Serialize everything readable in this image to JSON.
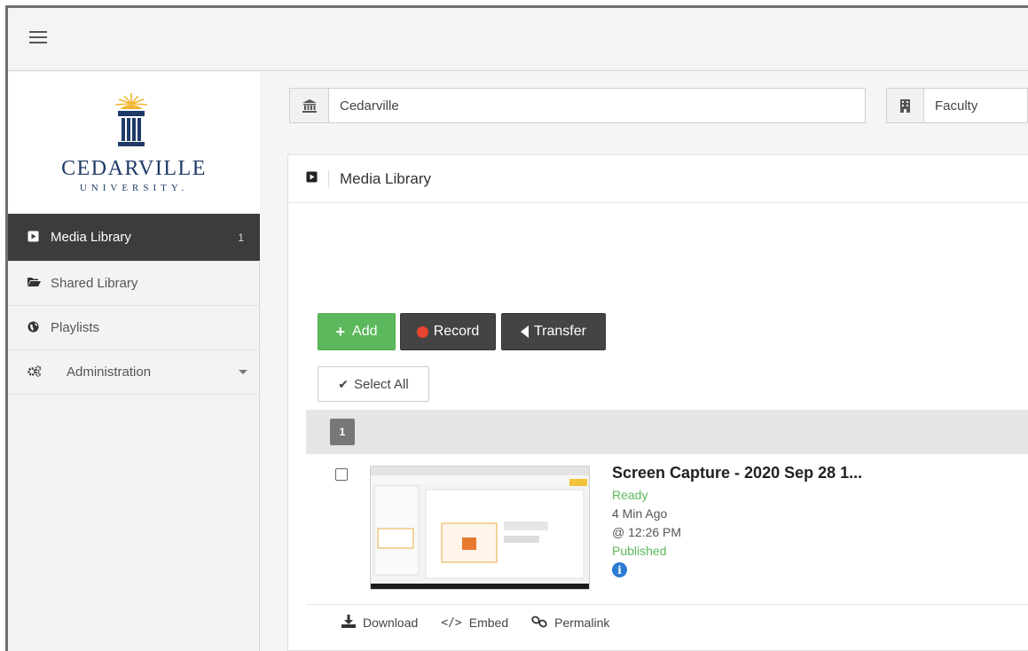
{
  "institution": {
    "value": "Cedarville"
  },
  "department": {
    "value": "Faculty"
  },
  "logo": {
    "name": "CEDARVILLE",
    "subtitle": "UNIVERSITY."
  },
  "sidebar": {
    "items": [
      {
        "label": "Media Library",
        "badge": "1",
        "icon": "play-square-icon"
      },
      {
        "label": "Shared Library",
        "icon": "folder-open-icon"
      },
      {
        "label": "Playlists",
        "icon": "globe-icon"
      },
      {
        "label": "Administration",
        "icon": "cogs-icon"
      }
    ]
  },
  "panel": {
    "title": "Media Library"
  },
  "toolbar": {
    "add_label": "Add",
    "record_label": "Record",
    "transfer_label": "Transfer",
    "select_all_label": "Select All"
  },
  "pagination": {
    "current": "1"
  },
  "media": {
    "title": "Screen Capture - 2020 Sep 28 1...",
    "status": "Ready",
    "age": "4 Min Ago",
    "time": "@ 12:26 PM",
    "publish_state": "Published",
    "info_glyph": "i"
  },
  "actions": {
    "download_label": "Download",
    "embed_label": "Embed",
    "permalink_label": "Permalink"
  },
  "colors": {
    "accent_green": "#5cb85c",
    "dark_button": "#444444",
    "active_nav": "#3c3c3c",
    "brand_navy": "#1f3a67",
    "logo_gold": "#f2b531"
  }
}
